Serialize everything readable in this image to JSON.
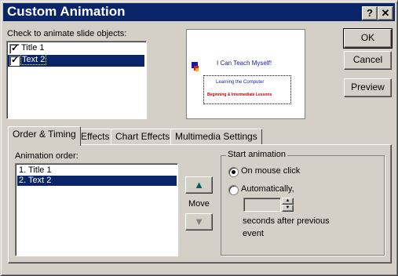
{
  "window": {
    "title": "Custom Animation",
    "help_label": "?",
    "close_label": "✕"
  },
  "objects_label": "Check to animate slide objects:",
  "objects": [
    {
      "label": "Title 1",
      "checked": true
    },
    {
      "label": "Text 2",
      "checked": true
    }
  ],
  "preview_slide": {
    "heading": "I Can Teach Myself!",
    "line1": "Learning the Computer",
    "line2": "Beginning & Intermediate Lessons"
  },
  "buttons": {
    "ok": "OK",
    "cancel": "Cancel",
    "preview": "Preview"
  },
  "tabs": [
    "Order & Timing",
    "Effects",
    "Chart Effects",
    "Multimedia Settings"
  ],
  "animation_order_label": "Animation order:",
  "animation_order": [
    "1. Title 1",
    "2. Text 2"
  ],
  "move_label": "Move",
  "start_animation": {
    "group_label": "Start animation",
    "on_click": "On mouse click",
    "automatically": "Automatically,",
    "seconds_value": "",
    "seconds_text": "seconds after previous",
    "event_text": "event"
  }
}
